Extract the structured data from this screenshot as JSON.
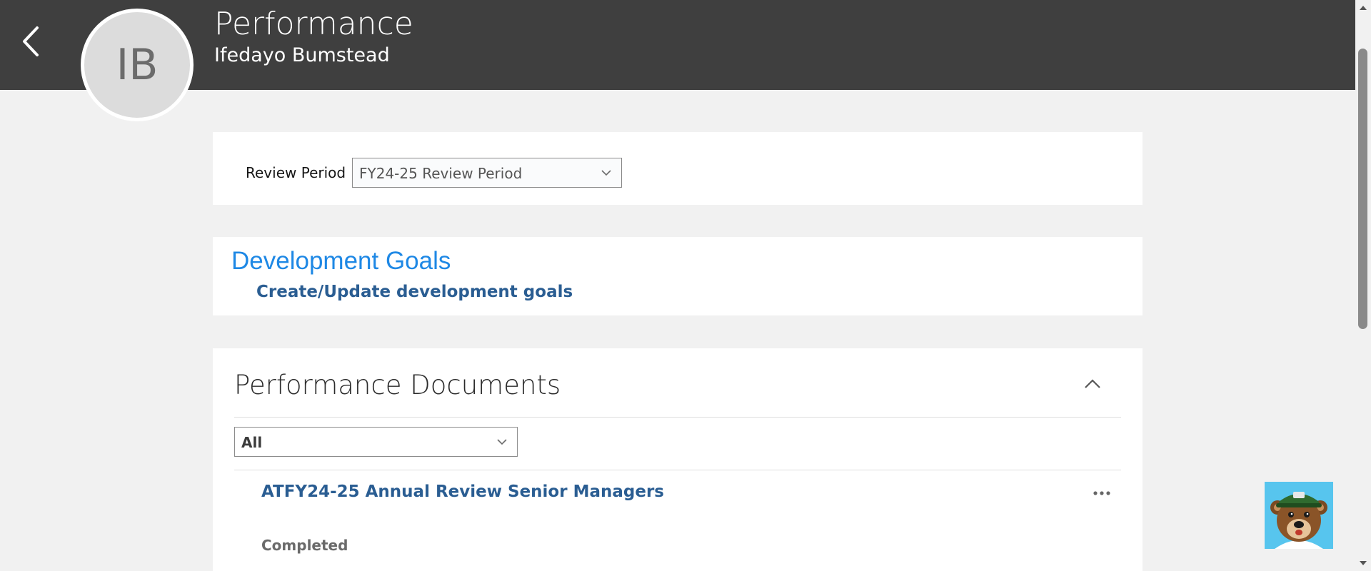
{
  "header": {
    "title": "Performance",
    "employee_name": "Ifedayo Bumstead",
    "avatar_initials": "IB",
    "back_icon": "chevron-left-icon"
  },
  "review_period": {
    "label": "Review Period",
    "selected": "FY24-25 Review Period"
  },
  "development_goals": {
    "title": "Development Goals",
    "link": "Create/Update development goals"
  },
  "performance_documents": {
    "title": "Performance Documents",
    "filter_selected": "All",
    "documents": [
      {
        "name": "ATFY24-25 Annual Review Senior Managers",
        "status": "Completed"
      }
    ]
  },
  "colors": {
    "header_bg": "#3f3f3f",
    "page_bg": "#f1f1f1",
    "accent_blue": "#1e88e5",
    "link_blue": "#2a5d92",
    "assistant_bg": "#57c5ee"
  },
  "icons": {
    "back": "chevron-left-icon",
    "dropdown": "chevron-down-icon",
    "collapse": "chevron-up-icon",
    "more": "more-horizontal-icon",
    "assistant": "bear-assistant-icon"
  }
}
